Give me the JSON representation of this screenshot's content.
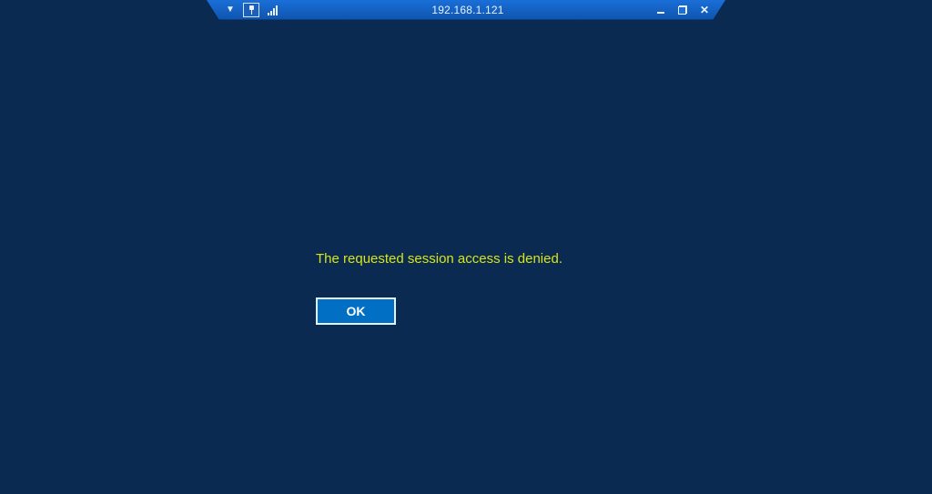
{
  "connection_bar": {
    "host": "192.168.1.121"
  },
  "message": {
    "text": "The requested session access is denied.",
    "ok_label": "OK"
  }
}
